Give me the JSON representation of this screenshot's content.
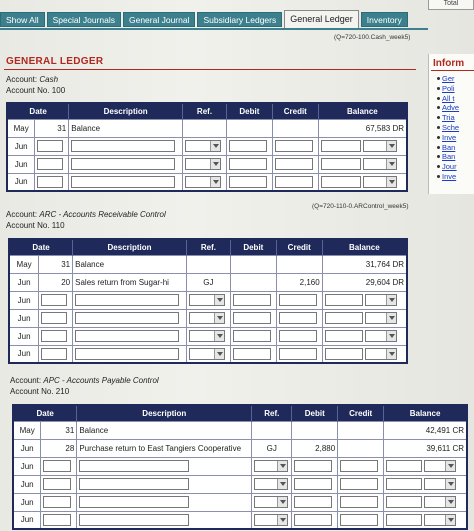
{
  "corner": {
    "label": "Total"
  },
  "tabs": [
    {
      "label": "Show All"
    },
    {
      "label": "Special Journals"
    },
    {
      "label": "General Journal"
    },
    {
      "label": "Subsidiary Ledgers"
    },
    {
      "label": "General Ledger"
    },
    {
      "label": "Inventory"
    }
  ],
  "notes": {
    "q1": "(Q=720-100.Cash_week5)",
    "q2": "(Q=720-110-0.ARControl_week5)"
  },
  "title": "GENERAL LEDGER",
  "headers": [
    "Date",
    "Description",
    "Ref.",
    "Debit",
    "Credit",
    "Balance"
  ],
  "accounts": [
    {
      "account_prefix": "Account: ",
      "account_name": "Cash",
      "account_no": "Account No. 100",
      "rows": [
        {
          "month": "May",
          "day": "31",
          "desc": "Balance",
          "ref": "",
          "debit": "",
          "credit": "",
          "balance": "67,583 DR"
        },
        {
          "month": "Jun"
        },
        {
          "month": "Jun"
        },
        {
          "month": "Jun"
        }
      ]
    },
    {
      "account_prefix": "Account: ",
      "account_name": "ARC - Accounts Receivable Control",
      "account_no": "Account No. 110",
      "rows": [
        {
          "month": "May",
          "day": "31",
          "desc": "Balance",
          "ref": "",
          "debit": "",
          "credit": "",
          "balance": "31,764 DR"
        },
        {
          "month": "Jun",
          "day": "20",
          "desc": "Sales return from Sugar-hi",
          "ref": "GJ",
          "debit": "",
          "credit": "2,160",
          "balance": "29,604 DR"
        },
        {
          "month": "Jun"
        },
        {
          "month": "Jun"
        },
        {
          "month": "Jun"
        },
        {
          "month": "Jun"
        }
      ]
    },
    {
      "account_prefix": "Account: ",
      "account_name": "APC - Accounts Payable Control",
      "account_no": "Account No. 210",
      "rows": [
        {
          "month": "May",
          "day": "31",
          "desc": "Balance",
          "ref": "",
          "debit": "",
          "credit": "",
          "balance": "42,491 CR"
        },
        {
          "month": "Jun",
          "day": "28",
          "desc": "Purchase return to East Tangiers Cooperative",
          "ref": "GJ",
          "debit": "2,880",
          "credit": "",
          "balance": "39,611 CR"
        },
        {
          "month": "Jun"
        },
        {
          "month": "Jun"
        },
        {
          "month": "Jun"
        },
        {
          "month": "Jun"
        }
      ]
    }
  ],
  "info": {
    "title": "Inform",
    "links": [
      "Ger",
      "Poli",
      "All t",
      "Adve",
      "Tria",
      "Sche",
      "Inve",
      "Ban",
      "Ban",
      "Jour",
      "Inve"
    ]
  },
  "colors": {
    "tab": "#3c7f8d",
    "header": "#1f2a5a",
    "title": "#b0281e",
    "link": "#1a3cc7"
  }
}
